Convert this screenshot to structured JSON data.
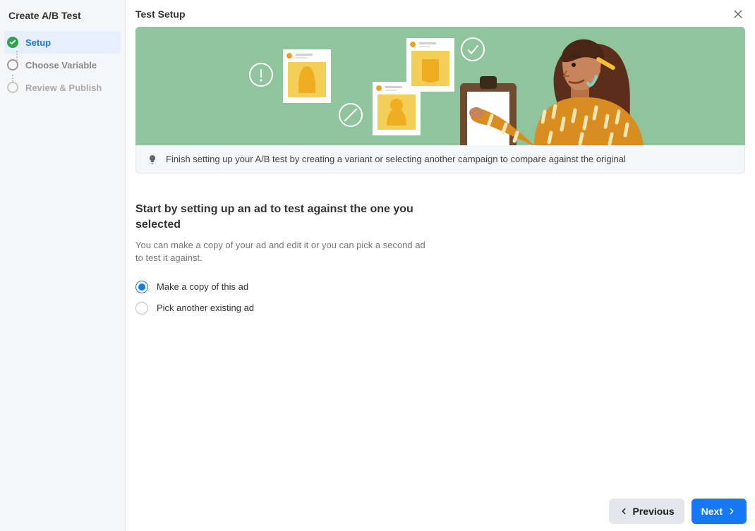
{
  "sidebar": {
    "title": "Create A/B Test",
    "steps": [
      {
        "label": "Setup",
        "state": "active"
      },
      {
        "label": "Choose Variable",
        "state": "pending"
      },
      {
        "label": "Review & Publish",
        "state": "future"
      }
    ]
  },
  "header": {
    "title": "Test Setup"
  },
  "info_bar": {
    "text": "Finish setting up your A/B test by creating a variant or selecting another campaign to compare against the original"
  },
  "section": {
    "heading": "Start by setting up an ad to test against the one you selected",
    "description": "You can make a copy of your ad and edit it or you can pick a second ad to test it against."
  },
  "options": [
    {
      "label": "Make a copy of this ad",
      "selected": true
    },
    {
      "label": "Pick another existing ad",
      "selected": false
    }
  ],
  "footer": {
    "previous": "Previous",
    "next": "Next"
  }
}
